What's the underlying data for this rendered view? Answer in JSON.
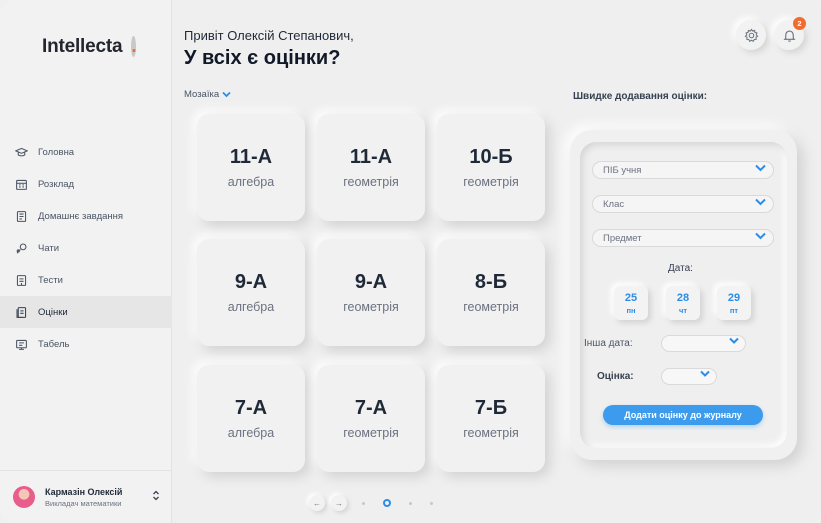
{
  "app": {
    "logo_text": "Intellecta",
    "logo_dot": ".",
    "accent_color": "#2b8de8",
    "brand_color": "#f26b2e"
  },
  "sidebar": {
    "items": [
      {
        "label": "Головна",
        "icon": "graduation-cap-icon"
      },
      {
        "label": "Розклад",
        "icon": "calendar-icon"
      },
      {
        "label": "Домашнє завдання",
        "icon": "homework-book-icon"
      },
      {
        "label": "Чати",
        "icon": "chat-icon"
      },
      {
        "label": "Тести",
        "icon": "test-sheet-icon"
      },
      {
        "label": "Оцінки",
        "icon": "grades-icon",
        "active": true
      },
      {
        "label": "Табель",
        "icon": "report-card-icon"
      }
    ]
  },
  "user": {
    "name": "Кармазін Олексій",
    "role": "Викладач математики",
    "toggle_icon": "⌃⌄"
  },
  "header": {
    "greeting": "Привіт Олексій Степанович,",
    "headline": "У всіх є оцінки?",
    "notifications_count": "2"
  },
  "view_toggle": {
    "label": "Мозаїка",
    "chevron": "⌄"
  },
  "tiles": [
    {
      "class": "11-А",
      "subject": "алгебра"
    },
    {
      "class": "11-А",
      "subject": "геометрія"
    },
    {
      "class": "10-Б",
      "subject": "геометрія"
    },
    {
      "class": "9-А",
      "subject": "алгебра"
    },
    {
      "class": "9-А",
      "subject": "геометрія"
    },
    {
      "class": "8-Б",
      "subject": "геометрія"
    },
    {
      "class": "7-А",
      "subject": "алгебра"
    },
    {
      "class": "7-А",
      "subject": "геометрія"
    },
    {
      "class": "7-Б",
      "subject": "геометрія"
    }
  ],
  "pager": {
    "prev": "←",
    "next": "→",
    "pages": 4,
    "current": 2
  },
  "quick_add": {
    "title": "Швидке додавання оцінки:",
    "student_placeholder": "ПІБ учня",
    "class_placeholder": "Клас",
    "subject_placeholder": "Предмет",
    "date_label": "Дата:",
    "dates": [
      {
        "day": "25",
        "weekday": "пн"
      },
      {
        "day": "28",
        "weekday": "чт"
      },
      {
        "day": "29",
        "weekday": "пт"
      }
    ],
    "other_date_label": "Інша дата:",
    "grade_label": "Оцінка:",
    "submit_label": "Додати оцінку до журналу"
  }
}
